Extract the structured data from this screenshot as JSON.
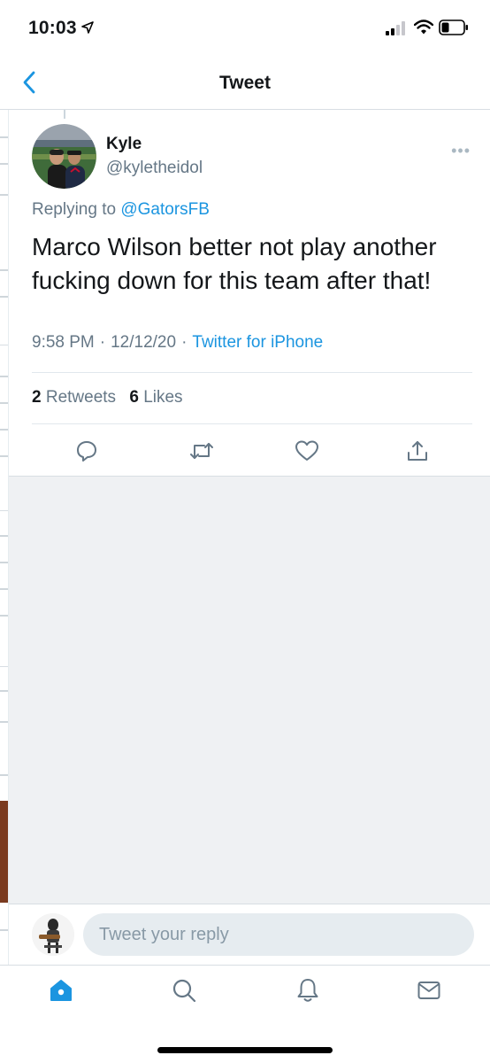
{
  "status_bar": {
    "time": "10:03"
  },
  "header": {
    "title": "Tweet"
  },
  "tweet": {
    "display_name": "Kyle",
    "handle": "@kyletheidol",
    "replying_prefix": "Replying to ",
    "replying_to": "@GatorsFB",
    "text": "Marco Wilson better not play another fucking down for this team after that!",
    "time": "9:58 PM",
    "date": "12/12/20",
    "meta_separator": "·",
    "source": "Twitter for iPhone",
    "retweets_count": "2",
    "retweets_label": "Retweets",
    "likes_count": "6",
    "likes_label": "Likes",
    "more_label": "•••"
  },
  "composer": {
    "placeholder": "Tweet your reply"
  },
  "colors": {
    "accent": "#1b95e0",
    "text_secondary": "#657786",
    "text_primary": "#14171a"
  },
  "icons": {
    "back": "chevron-left-icon",
    "reply": "reply-icon",
    "retweet": "retweet-icon",
    "like": "heart-icon",
    "share": "share-icon",
    "tabs": [
      "home-icon",
      "search-icon",
      "bell-icon",
      "mail-icon"
    ]
  }
}
